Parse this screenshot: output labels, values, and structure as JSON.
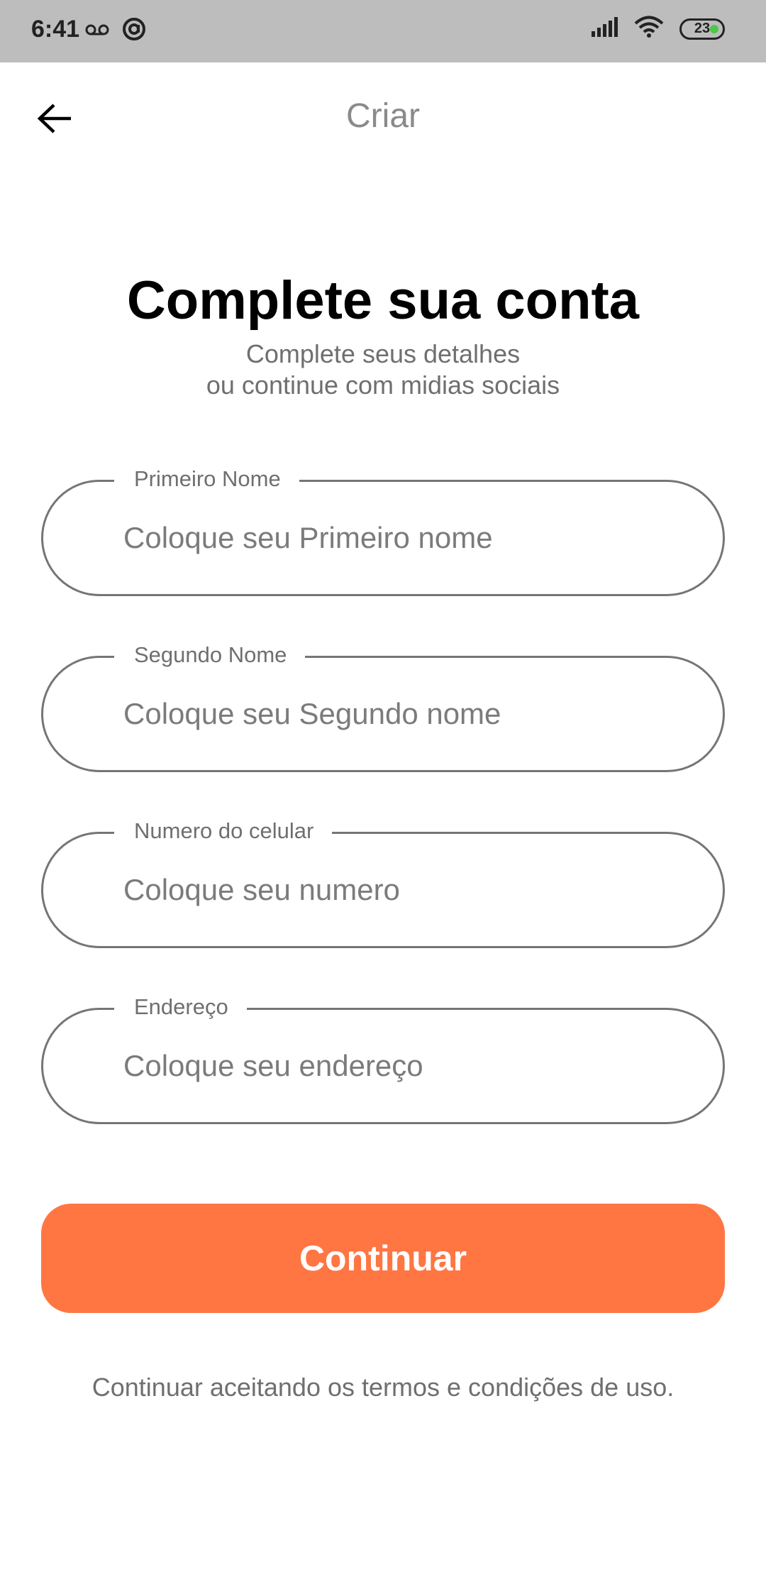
{
  "status_bar": {
    "time": "6:41",
    "battery_level": "23",
    "icons": [
      "voicemail-icon",
      "at-icon",
      "signal-icon",
      "wifi-icon",
      "battery-icon"
    ]
  },
  "app_bar": {
    "title": "Criar",
    "back_icon": "arrow-left-icon"
  },
  "header": {
    "title": "Complete sua conta",
    "subtitle_line1": "Complete seus detalhes",
    "subtitle_line2": "ou continue com midias sociais"
  },
  "form": {
    "first_name": {
      "label": "Primeiro Nome",
      "placeholder": "Coloque seu Primeiro nome",
      "value": ""
    },
    "last_name": {
      "label": "Segundo Nome",
      "placeholder": "Coloque seu Segundo nome",
      "value": ""
    },
    "phone": {
      "label": "Numero do celular",
      "placeholder": "Coloque seu numero",
      "value": ""
    },
    "address": {
      "label": "Endereço",
      "placeholder": "Coloque seu endereço",
      "value": ""
    }
  },
  "continue_button": {
    "label": "Continuar"
  },
  "terms_text": "Continuar aceitando os termos e condições de uso.",
  "colors": {
    "accent": "#ff7643",
    "status_bar": "#bdbdbd",
    "field_border": "#757575",
    "muted_text": "#6f6f6f"
  }
}
